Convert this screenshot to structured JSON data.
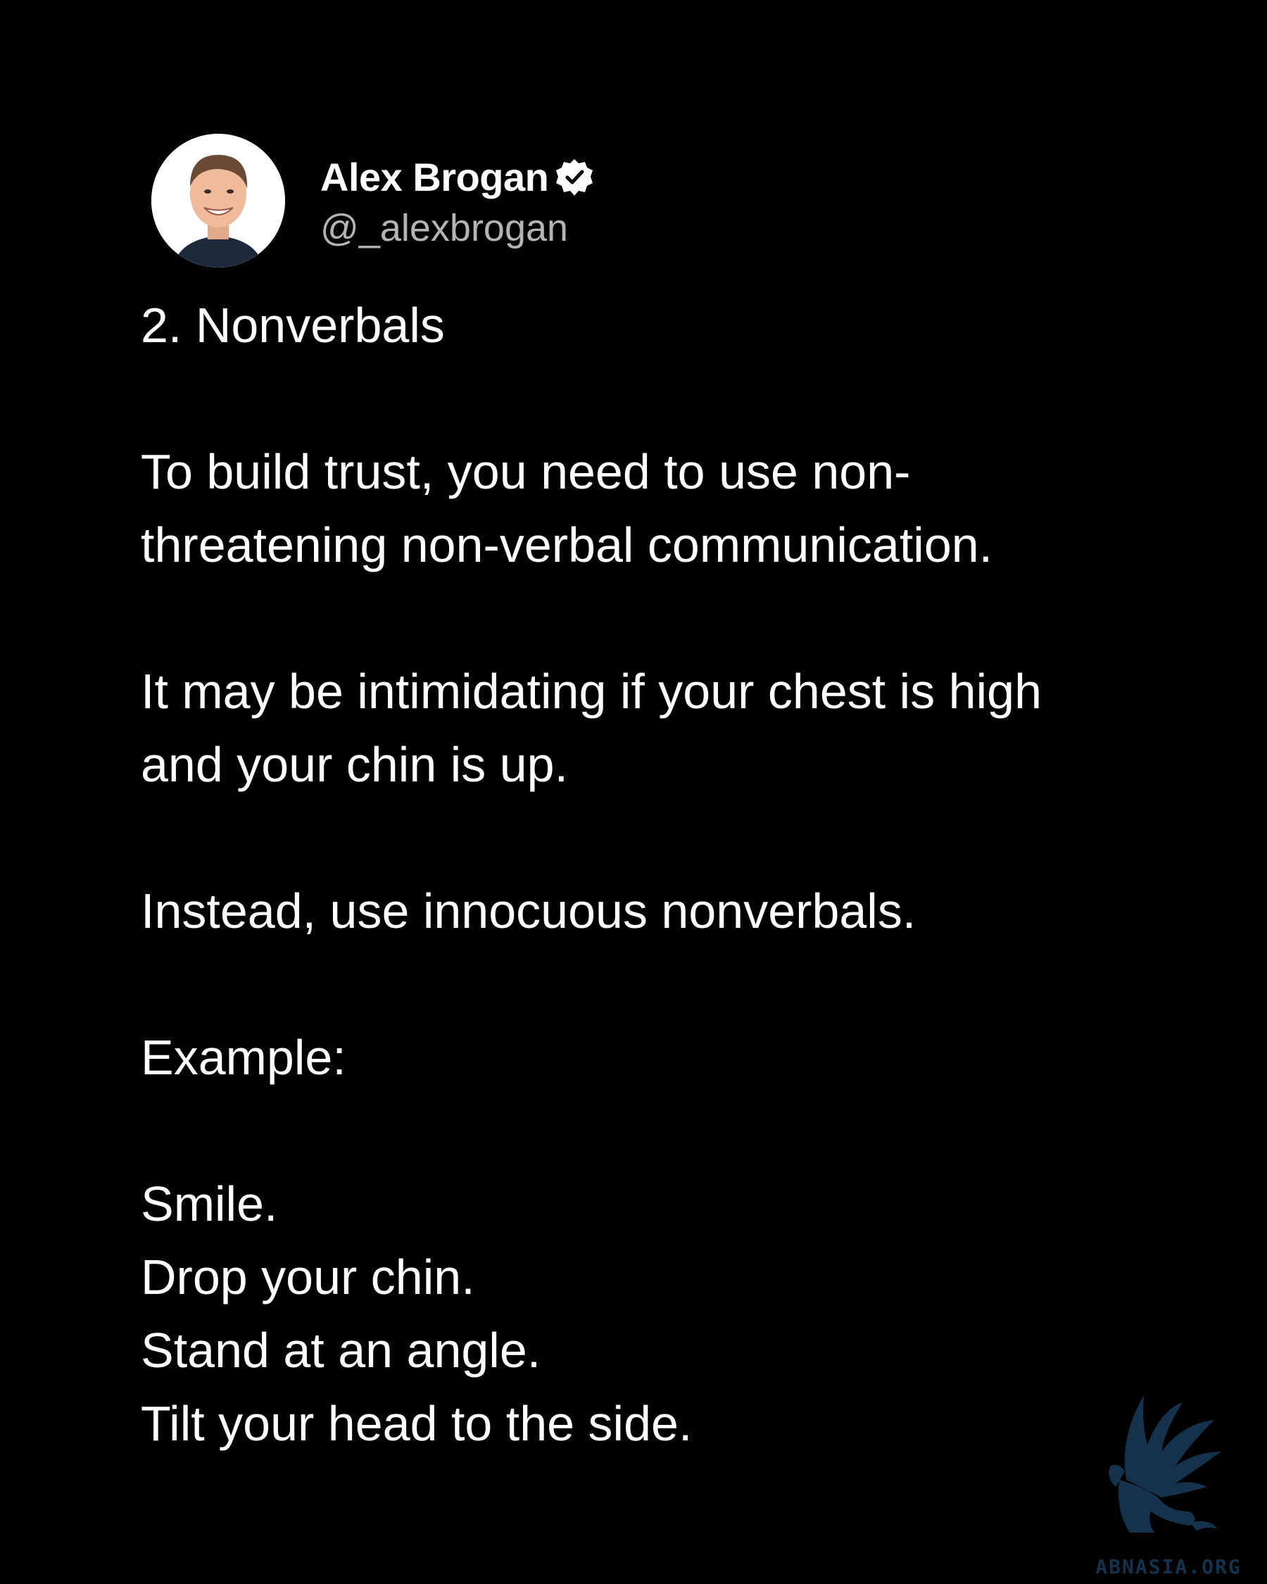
{
  "author": {
    "display_name": "Alex Brogan",
    "handle": "@_alexbrogan",
    "verified_icon": "verified-badge-icon",
    "avatar": "profile-photo"
  },
  "post": {
    "heading": "2. Nonverbals",
    "paragraph_1": {
      "line_1": "To build trust, you need to use non-",
      "line_2": "threatening non-verbal communication."
    },
    "paragraph_2": {
      "line_1": "It may be intimidating if your chest is high",
      "line_2": "and your chin is up."
    },
    "paragraph_3": "Instead, use innocuous nonverbals.",
    "example_label": "Example:",
    "examples": [
      "Smile.",
      "Drop your chin.",
      "Stand at an angle.",
      "Tilt your head to the side."
    ]
  },
  "watermark": {
    "text": "ABNASIA.ORG",
    "logo": "griffin-logo",
    "color": "#15324d"
  },
  "colors": {
    "background": "#000000",
    "text": "#ffffff",
    "handle": "#b4b4b4"
  }
}
